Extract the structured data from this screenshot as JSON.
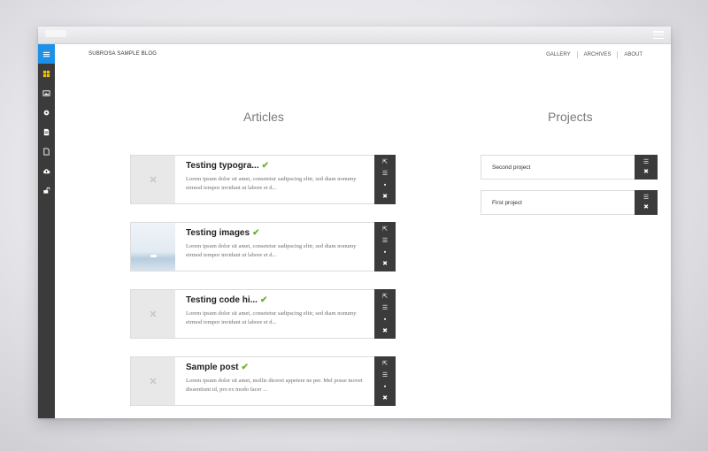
{
  "blog_title": "SUBROSA SAMPLE BLOG",
  "nav": [
    {
      "label": "GALLERY"
    },
    {
      "label": "ARCHIVES"
    },
    {
      "label": "ABOUT"
    }
  ],
  "sidebar": [
    {
      "icon": "menu-icon",
      "active": true
    },
    {
      "icon": "dashboard-icon",
      "active": false
    },
    {
      "icon": "image-icon",
      "active": false
    },
    {
      "icon": "gear-icon",
      "active": false
    },
    {
      "icon": "document-icon",
      "active": false
    },
    {
      "icon": "page-icon",
      "active": false
    },
    {
      "icon": "cloud-upload-icon",
      "active": false
    },
    {
      "icon": "unlock-icon",
      "active": false
    }
  ],
  "articles": {
    "heading": "Articles",
    "items": [
      {
        "title": "Testing typogra...",
        "excerpt": "Lorem ipsum dolor sit amet, consetetur sadipscing elitr, sed diam nonumy eirmod tempor invidunt ut labore et d...",
        "published": true,
        "has_image": false
      },
      {
        "title": "Testing images",
        "excerpt": "Lorem ipsum dolor sit amet, consetetur sadipscing elitr, sed diam nonumy eirmod tempor invidunt ut labore et d...",
        "published": true,
        "has_image": true
      },
      {
        "title": "Testing code hi...",
        "excerpt": "Lorem ipsum dolor sit amet, consetetur sadipscing elitr, sed diam nonumy eirmod tempor invidunt ut labore et d...",
        "published": true,
        "has_image": false
      },
      {
        "title": "Sample post",
        "excerpt": "Lorem ipsum dolor sit amet, mollis diceret appetere ne per. Mel posse movet dissentiunt id, pro ex modo facer ...",
        "published": true,
        "has_image": false
      }
    ]
  },
  "projects": {
    "heading": "Projects",
    "items": [
      {
        "name": "Second project"
      },
      {
        "name": "First project"
      }
    ]
  },
  "colors": {
    "sidebar_bg": "#3b3b3c",
    "sidebar_active": "#1e90e8",
    "check": "#6ab42c"
  }
}
